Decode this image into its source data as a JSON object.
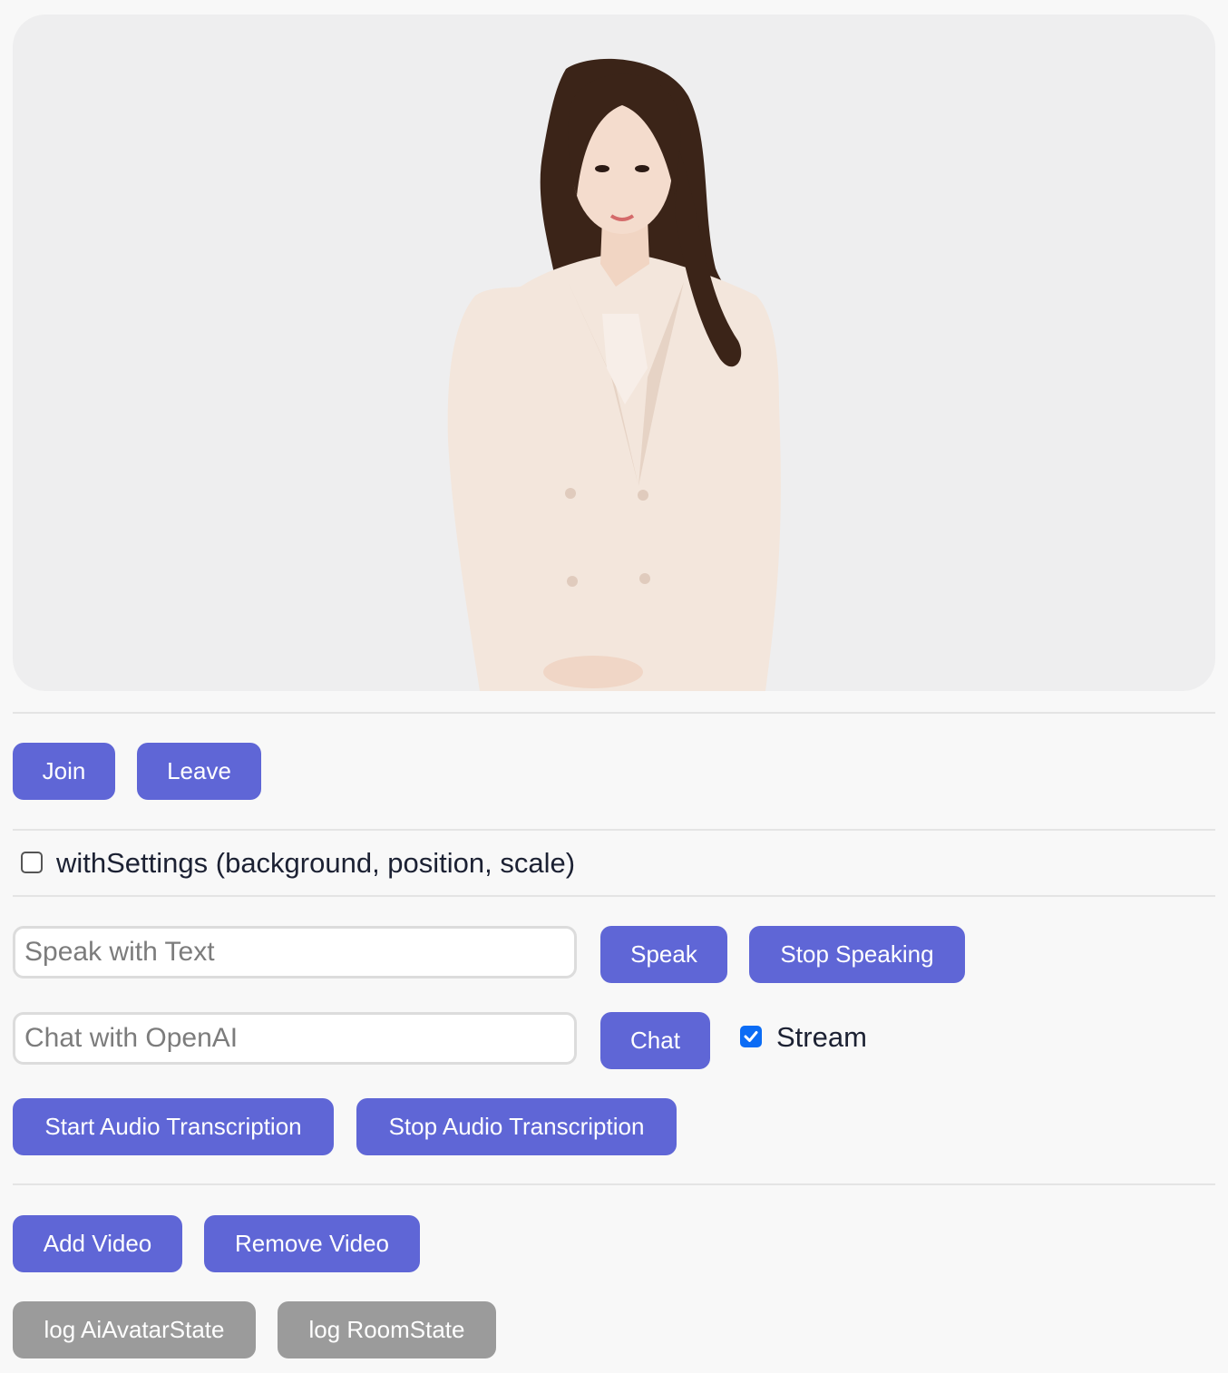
{
  "avatar_panel": {
    "video_frame": "ai-avatar-video"
  },
  "session_controls": {
    "join_label": "Join",
    "leave_label": "Leave"
  },
  "settings": {
    "with_settings_label": "withSettings (background, position, scale)",
    "with_settings_checked": false
  },
  "speak": {
    "placeholder": "Speak with Text",
    "value": "",
    "speak_label": "Speak",
    "stop_label": "Stop Speaking"
  },
  "chat": {
    "placeholder": "Chat with OpenAI",
    "value": "",
    "chat_label": "Chat",
    "stream_label": "Stream",
    "stream_checked": true
  },
  "transcription": {
    "start_label": "Start Audio Transcription",
    "stop_label": "Stop Audio Transcription"
  },
  "video_controls": {
    "add_label": "Add Video",
    "remove_label": "Remove Video"
  },
  "debug": {
    "log_avatar_label": "log AiAvatarState",
    "log_room_label": "log RoomState"
  },
  "colors": {
    "primary_button": "#5f66d6",
    "secondary_button": "#9b9b9b",
    "checkbox_checked": "#0b6cf5",
    "video_background": "#eeeeef"
  }
}
